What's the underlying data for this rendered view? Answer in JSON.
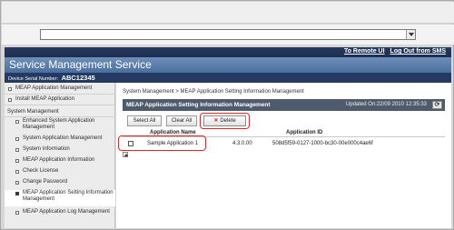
{
  "header": {
    "links": [
      "To Remote UI",
      "Log Out from SMS"
    ],
    "title": "Service Management Service",
    "serial_label": "Device Serial Number:",
    "serial_value": "ABC12345"
  },
  "sidebar": {
    "items": [
      {
        "label": "MEAP Application Management"
      },
      {
        "label": "Install MEAP Application"
      },
      {
        "label": "System Management"
      },
      {
        "label": "Enhanced System Application Management"
      },
      {
        "label": "System Application Management"
      },
      {
        "label": "System Information"
      },
      {
        "label": "MEAP Application Information"
      },
      {
        "label": "Check License"
      },
      {
        "label": "Change Password"
      },
      {
        "label": "MEAP Application Setting Information Management"
      },
      {
        "label": "MEAP Application Log Management"
      }
    ]
  },
  "content": {
    "breadcrumb": "System Management > MEAP Application Setting Information Management",
    "panel_title": "MEAP Application Setting Information Management",
    "updated": "Updated On:22/09 2010 12:35:33",
    "buttons": {
      "select_all": "Select All",
      "clear_all": "Clear All",
      "delete": "Delete"
    },
    "table": {
      "columns": [
        "Application Name",
        "Application ID"
      ],
      "rows": [
        {
          "name": "Sample Application 1",
          "version": "4.3.0.00",
          "id": "508d5f59-0127-1000-bc30-00e000c4ae6f"
        }
      ]
    }
  }
}
